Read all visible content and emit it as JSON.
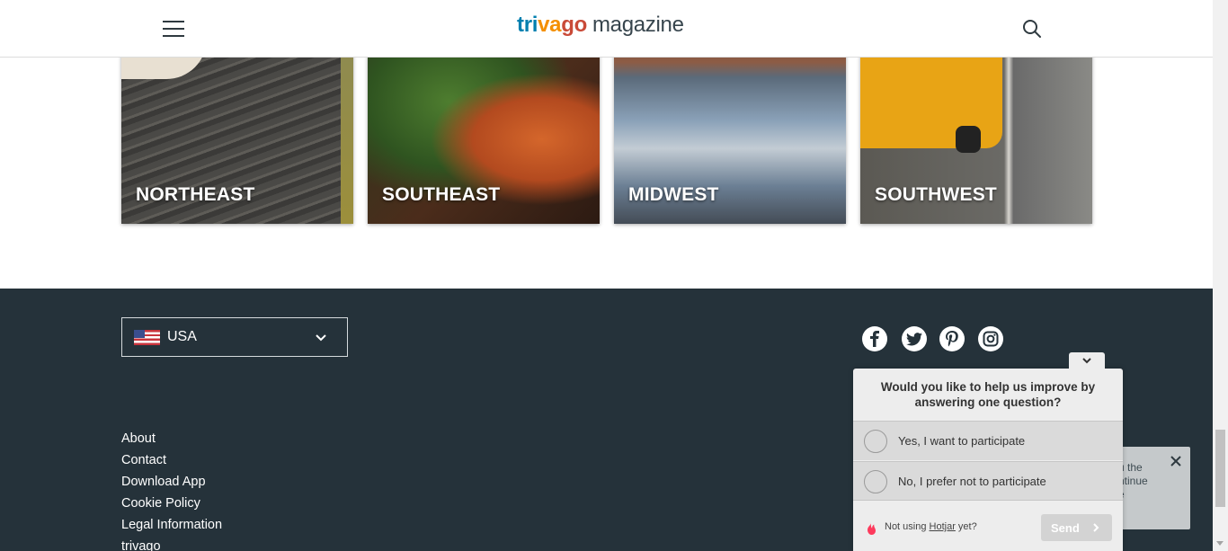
{
  "header": {
    "logo": {
      "part_tri": "tri",
      "part_va": "va",
      "part_go": "go",
      "part_magazine": "magazine"
    },
    "menu_icon": "hamburger-menu-icon",
    "search_icon": "search-icon"
  },
  "regions": [
    {
      "label": "NORTHEAST"
    },
    {
      "label": "SOUTHEAST"
    },
    {
      "label": "MIDWEST"
    },
    {
      "label": "SOUTHWEST"
    }
  ],
  "footer": {
    "country_select": {
      "value": "USA",
      "flag_icon": "us-flag-icon"
    },
    "social": [
      "facebook-icon",
      "twitter-icon",
      "pinterest-icon",
      "instagram-icon"
    ],
    "links": [
      "About",
      "Contact",
      "Download App",
      "Cookie Policy",
      "Legal Information",
      "trivago"
    ],
    "background": "#25323a"
  },
  "survey": {
    "question": "Would you like to help us improve by answering one question?",
    "options": [
      "Yes, I want to participate",
      "No, I prefer not to participate"
    ],
    "footer_prefix": "Not using ",
    "footer_link": "Hotjar",
    "footer_suffix": " yet?",
    "send_label": "Send"
  },
  "notice": {
    "text": "u the\nntinue\ne"
  },
  "colors": {
    "logo_blue": "#007faf",
    "logo_orange": "#f48f00",
    "logo_red": "#c94a38",
    "logo_gray": "#37454d"
  }
}
